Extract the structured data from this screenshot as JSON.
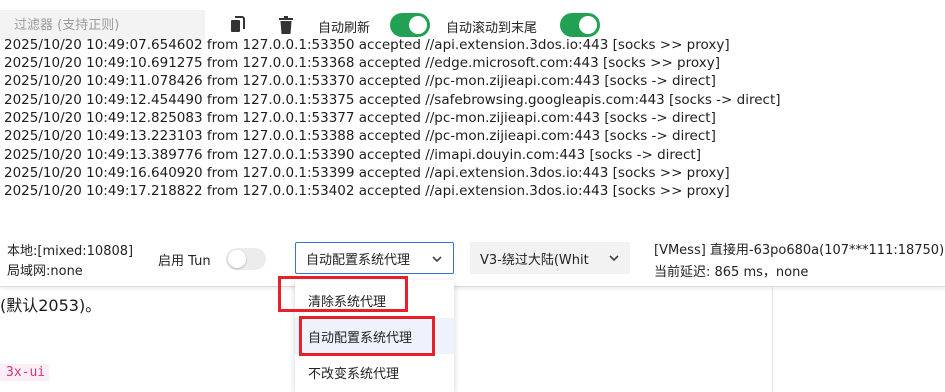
{
  "background": {
    "paragraph_text": "(默认2053)。",
    "code_text": "3x-ui"
  },
  "toolbar": {
    "filter_placeholder": "过滤器 (支持正则)",
    "auto_refresh_label": "自动刷新",
    "auto_scroll_label": "自动滚动到末尾",
    "auto_refresh_on": true,
    "auto_scroll_on": true,
    "icons": [
      "copy-icon",
      "trash-icon"
    ]
  },
  "log": {
    "lines": [
      "2025/10/20 10:49:07.654602 from 127.0.0.1:53350 accepted //api.extension.3dos.io:443 [socks >> proxy]",
      "2025/10/20 10:49:10.691275 from 127.0.0.1:53368 accepted //edge.microsoft.com:443 [socks >> proxy]",
      "2025/10/20 10:49:11.078426 from 127.0.0.1:53370 accepted //pc-mon.zijieapi.com:443 [socks -> direct]",
      "2025/10/20 10:49:12.454490 from 127.0.0.1:53375 accepted //safebrowsing.googleapis.com:443 [socks -> direct]",
      "2025/10/20 10:49:12.825083 from 127.0.0.1:53377 accepted //pc-mon.zijieapi.com:443 [socks -> direct]",
      "2025/10/20 10:49:13.223103 from 127.0.0.1:53388 accepted //pc-mon.zijieapi.com:443 [socks -> direct]",
      "2025/10/20 10:49:13.389776 from 127.0.0.1:53390 accepted //imapi.douyin.com:443 [socks -> direct]",
      "2025/10/20 10:49:16.640920 from 127.0.0.1:53399 accepted //api.extension.3dos.io:443 [socks >> proxy]",
      "2025/10/20 10:49:17.218822 from 127.0.0.1:53402 accepted //api.extension.3dos.io:443 [socks >> proxy]"
    ]
  },
  "status": {
    "local_label": "本地:[mixed:10808]",
    "lan_label": "局域网:none",
    "tun_label": "启用 Tun",
    "tun_on": false,
    "proxy_mode_value": "自动配置系统代理",
    "routing_value": "V3-绕过大陆(Whit",
    "server_label": "[VMess] 直接用-63po680a(107***111:18750)",
    "latency_label": "当前延迟: 865 ms，none"
  },
  "dropdown": {
    "options": [
      "清除系统代理",
      "自动配置系统代理",
      "不改变系统代理"
    ],
    "selected": "自动配置系统代理"
  },
  "colors": {
    "switch_on": "#22a155",
    "select_border": "#3b6fd8",
    "highlight_red": "#e8202a",
    "selected_option_bg": "#edf2fd"
  }
}
